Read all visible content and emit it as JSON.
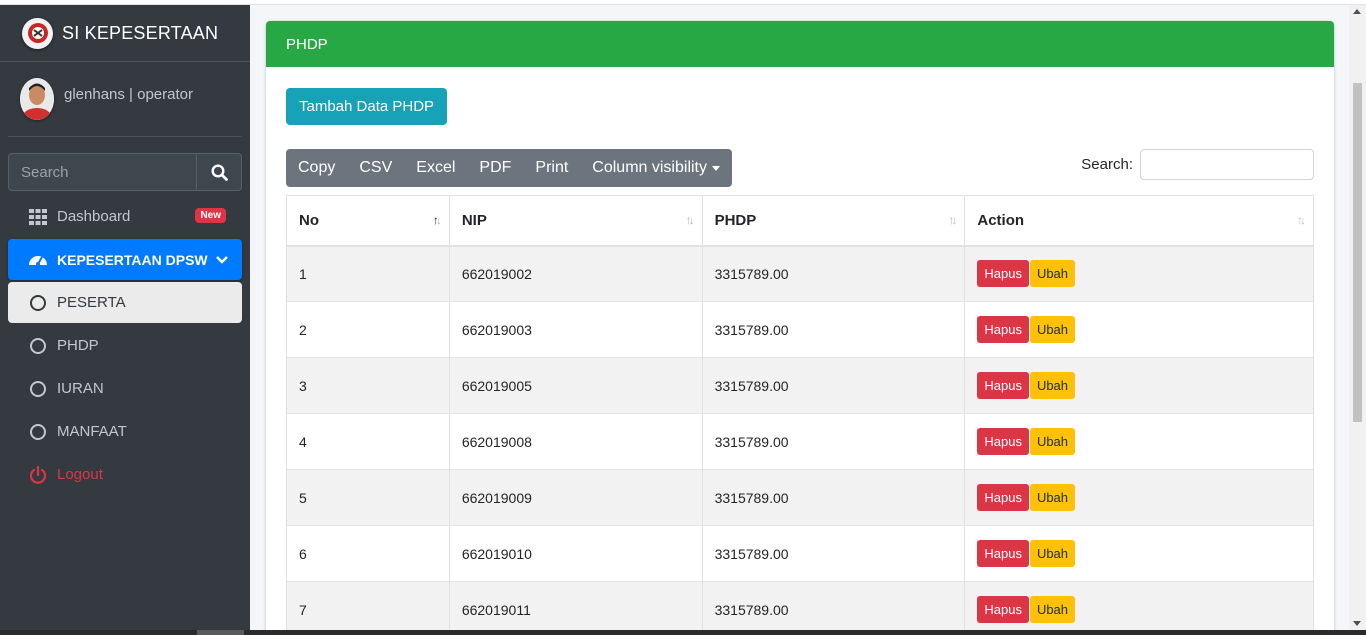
{
  "brand": {
    "title": "SI KEPESERTAAN"
  },
  "user": {
    "name": "glenhans | operator"
  },
  "sidebar_search": {
    "placeholder": "Search"
  },
  "nav": {
    "dashboard": {
      "label": "Dashboard",
      "badge": "New"
    },
    "kepesertaan": {
      "label": "KEPESERTAAN DPSW"
    },
    "peserta": {
      "label": "PESERTA"
    },
    "phdp": {
      "label": "PHDP"
    },
    "iuran": {
      "label": "IURAN"
    },
    "manfaat": {
      "label": "MANFAAT"
    },
    "logout": {
      "label": "Logout"
    }
  },
  "card": {
    "title": "PHDP",
    "add_button": "Tambah Data PHDP"
  },
  "export_buttons": {
    "copy": "Copy",
    "csv": "CSV",
    "excel": "Excel",
    "pdf": "PDF",
    "print": "Print",
    "colvis": "Column visibility"
  },
  "table_search": {
    "label": "Search:",
    "value": ""
  },
  "table": {
    "headers": {
      "no": "No",
      "nip": "NIP",
      "phdp": "PHDP",
      "action": "Action"
    },
    "action_labels": {
      "delete": "Hapus",
      "edit": "Ubah"
    },
    "rows": [
      {
        "no": "1",
        "nip": "662019002",
        "phdp": "3315789.00"
      },
      {
        "no": "2",
        "nip": "662019003",
        "phdp": "3315789.00"
      },
      {
        "no": "3",
        "nip": "662019005",
        "phdp": "3315789.00"
      },
      {
        "no": "4",
        "nip": "662019008",
        "phdp": "3315789.00"
      },
      {
        "no": "5",
        "nip": "662019009",
        "phdp": "3315789.00"
      },
      {
        "no": "6",
        "nip": "662019010",
        "phdp": "3315789.00"
      },
      {
        "no": "7",
        "nip": "662019011",
        "phdp": "3315789.00"
      }
    ]
  },
  "colors": {
    "sidebar": "#343a40",
    "header_green": "#28a745",
    "active_blue": "#007bff",
    "info": "#17a2b8",
    "danger": "#dc3545",
    "warning": "#ffc107",
    "secondary": "#6c757d"
  }
}
